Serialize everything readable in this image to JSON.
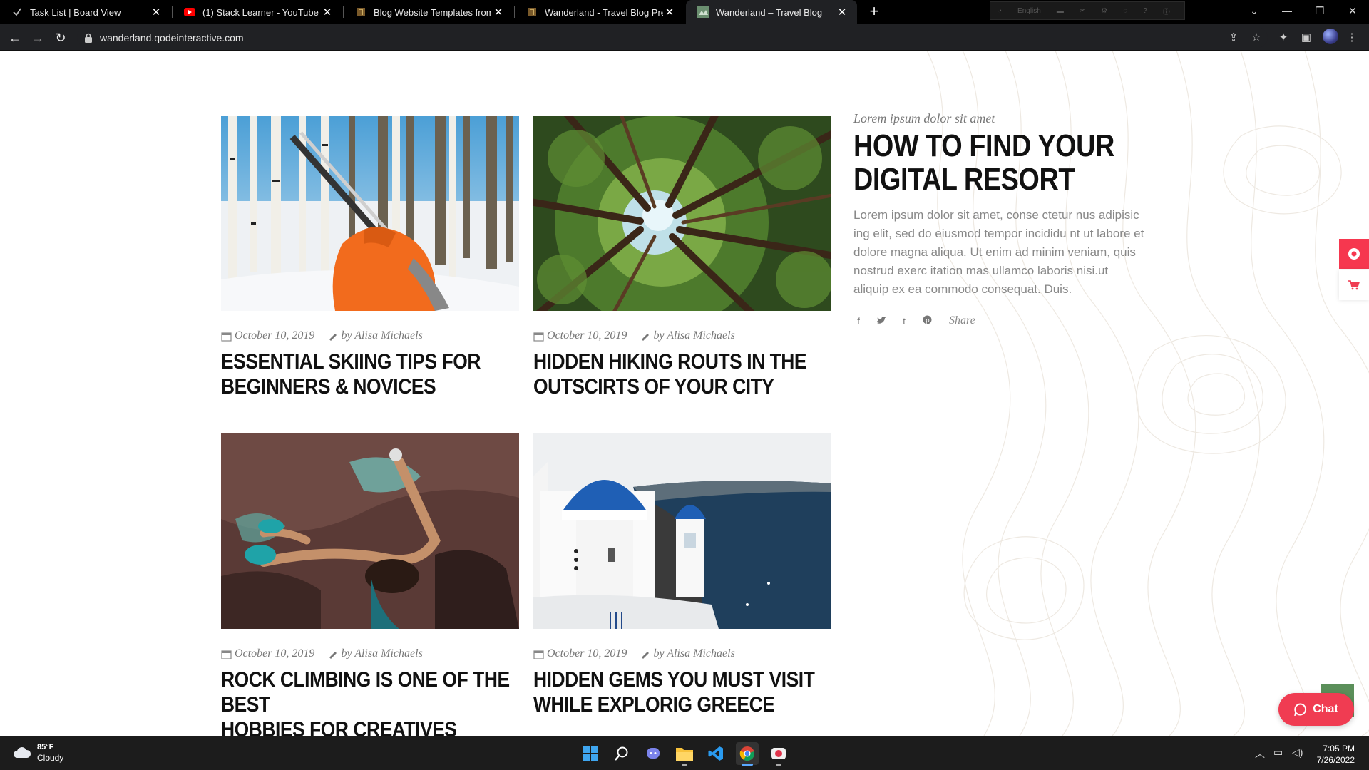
{
  "browser": {
    "tabs": [
      {
        "title": "Task List | Board View",
        "active": false
      },
      {
        "title": "(1) Stack Learner - YouTube",
        "active": false
      },
      {
        "title": "Blog Website Templates from Th",
        "active": false
      },
      {
        "title": "Wanderland - Travel Blog Preview",
        "active": false
      },
      {
        "title": "Wanderland – Travel Blog",
        "active": true
      }
    ],
    "close_glyph": "✕",
    "new_tab_glyph": "+",
    "extension_language": "English",
    "url": "wanderland.qodeinteractive.com"
  },
  "posts": [
    {
      "date": "October 10, 2019",
      "author": "by Alisa Michaels",
      "title_line1": "ESSENTIAL SKIING TIPS FOR",
      "title_line2": "BEGINNERS & NOVICES"
    },
    {
      "date": "October 10, 2019",
      "author": "by Alisa Michaels",
      "title_line1": "HIDDEN HIKING ROUTS IN THE",
      "title_line2": "OUTSCIRTS OF YOUR CITY"
    },
    {
      "date": "October 10, 2019",
      "author": "by Alisa Michaels",
      "title_line1": "ROCK CLIMBING IS ONE OF THE BEST",
      "title_line2": "HOBBIES FOR CREATIVES"
    },
    {
      "date": "October 10, 2019",
      "author": "by Alisa Michaels",
      "title_line1": "HIDDEN GEMS YOU MUST VISIT",
      "title_line2": "WHILE EXPLORIG GREECE"
    }
  ],
  "featured": {
    "kicker": "Lorem ipsum dolor sit amet",
    "title_line1": "HOW TO FIND YOUR",
    "title_line2": "DIGITAL RESORT",
    "excerpt": "Lorem ipsum dolor sit amet, conse ctetur nus adipisic ing elit, sed do eiusmod tempor incididu nt ut labore et dolore magna aliqua. Ut enim ad minim veniam, quis nostrud exerc itation mas ullamco laboris nisi.ut aliquip ex ea commodo consequat. Duis.",
    "share_label": "Share",
    "share_icons": [
      "facebook-icon",
      "twitter-icon",
      "tumblr-icon",
      "pinterest-icon"
    ]
  },
  "chat": {
    "label": "Chat"
  },
  "colors": {
    "accent": "#f03c52",
    "side_accent": "#f6374f",
    "scroll_top": "#5b8f5a"
  },
  "taskbar": {
    "weather_temp": "85°F",
    "weather_desc": "Cloudy",
    "time": "7:05 PM",
    "date": "7/26/2022"
  }
}
